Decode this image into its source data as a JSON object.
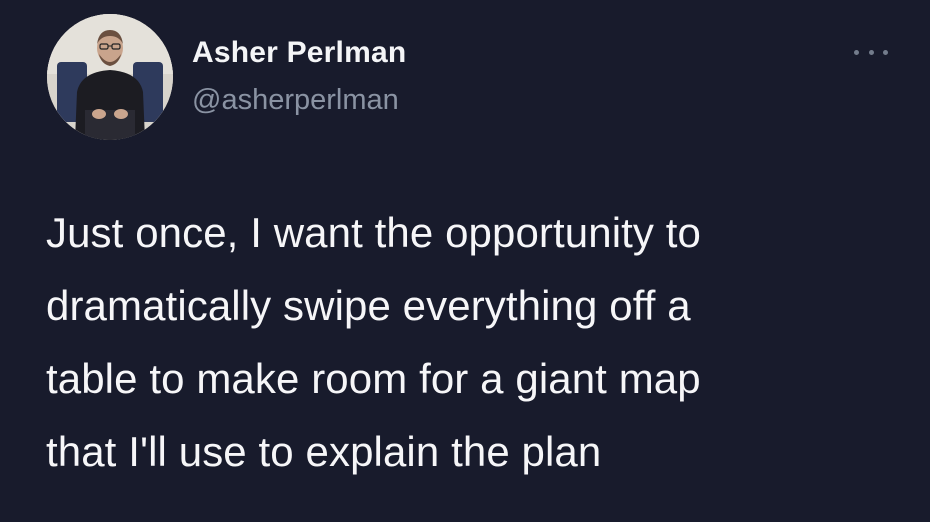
{
  "tweet": {
    "author": {
      "display_name": "Asher Perlman",
      "handle": "@asherperlman",
      "avatar_icon": "profile-photo"
    },
    "more_options_icon": "ellipsis-icon",
    "text_lines": [
      "Just once, I want the opportunity to",
      "dramatically swipe everything off a",
      "table to make room for a giant map",
      "that I'll use to explain the plan"
    ]
  },
  "colors": {
    "background": "#181b2c",
    "text_primary": "#f6f6f8",
    "text_secondary": "#8a93a3"
  }
}
